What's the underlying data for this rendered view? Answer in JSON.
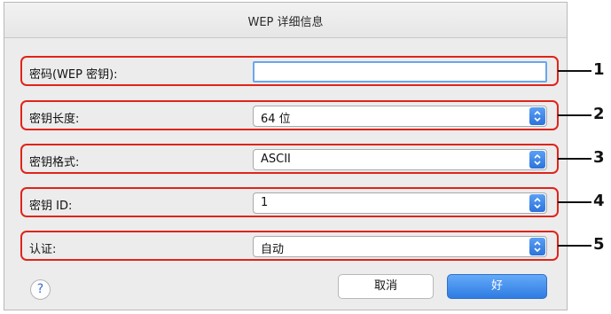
{
  "dialog": {
    "title": "WEP 详细信息"
  },
  "rows": [
    {
      "label": "密码(WEP 密钥):",
      "value": "",
      "callout": "1"
    },
    {
      "label": "密钥长度:",
      "value": "64 位",
      "callout": "2"
    },
    {
      "label": "密钥格式:",
      "value": "ASCII",
      "callout": "3"
    },
    {
      "label": "密钥 ID:",
      "value": "1",
      "callout": "4"
    },
    {
      "label": "认证:",
      "value": "自动",
      "callout": "5"
    }
  ],
  "buttons": {
    "help": "?",
    "cancel": "取消",
    "ok": "好"
  },
  "colors": {
    "callout_border": "#e0241b",
    "accent": "#2e7be3"
  }
}
